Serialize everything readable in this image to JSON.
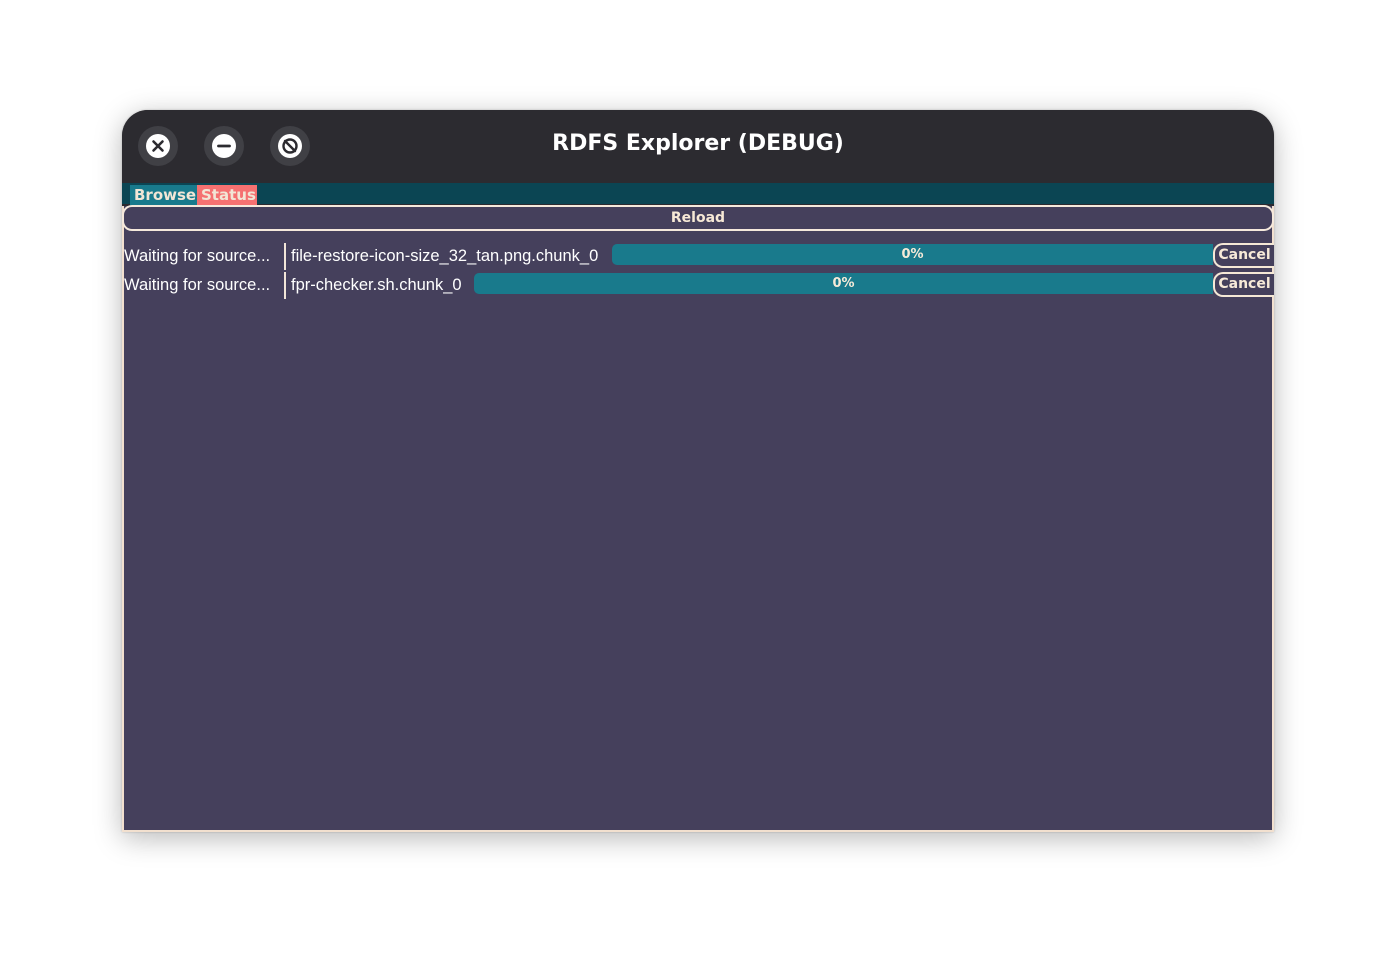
{
  "window": {
    "title": "RDFS Explorer (DEBUG)"
  },
  "window_controls": [
    {
      "name": "close-icon"
    },
    {
      "name": "minimize-icon"
    },
    {
      "name": "maximize-icon"
    }
  ],
  "tabs": [
    {
      "label": "Browse",
      "active": false
    },
    {
      "label": "Status",
      "active": true
    }
  ],
  "toolbar": {
    "reload_label": "Reload"
  },
  "transfers": [
    {
      "status": "Waiting for source...",
      "file": "file-restore-icon-size_32_tan.png.chunk_0",
      "progress": 0,
      "progress_label": "0%",
      "cancel_label": "Cancel"
    },
    {
      "status": "Waiting for source...",
      "file": "fpr-checker.sh.chunk_0",
      "progress": 0,
      "progress_label": "0%",
      "cancel_label": "Cancel"
    }
  ],
  "colors": {
    "titlebar": "#2c2b30",
    "tabbar": "#0b4553",
    "tab_browse": "#197a8c",
    "tab_status": "#f57171",
    "content_bg": "#45405c",
    "progress_bg": "#197a8c",
    "accent_text": "#f7ead8"
  }
}
